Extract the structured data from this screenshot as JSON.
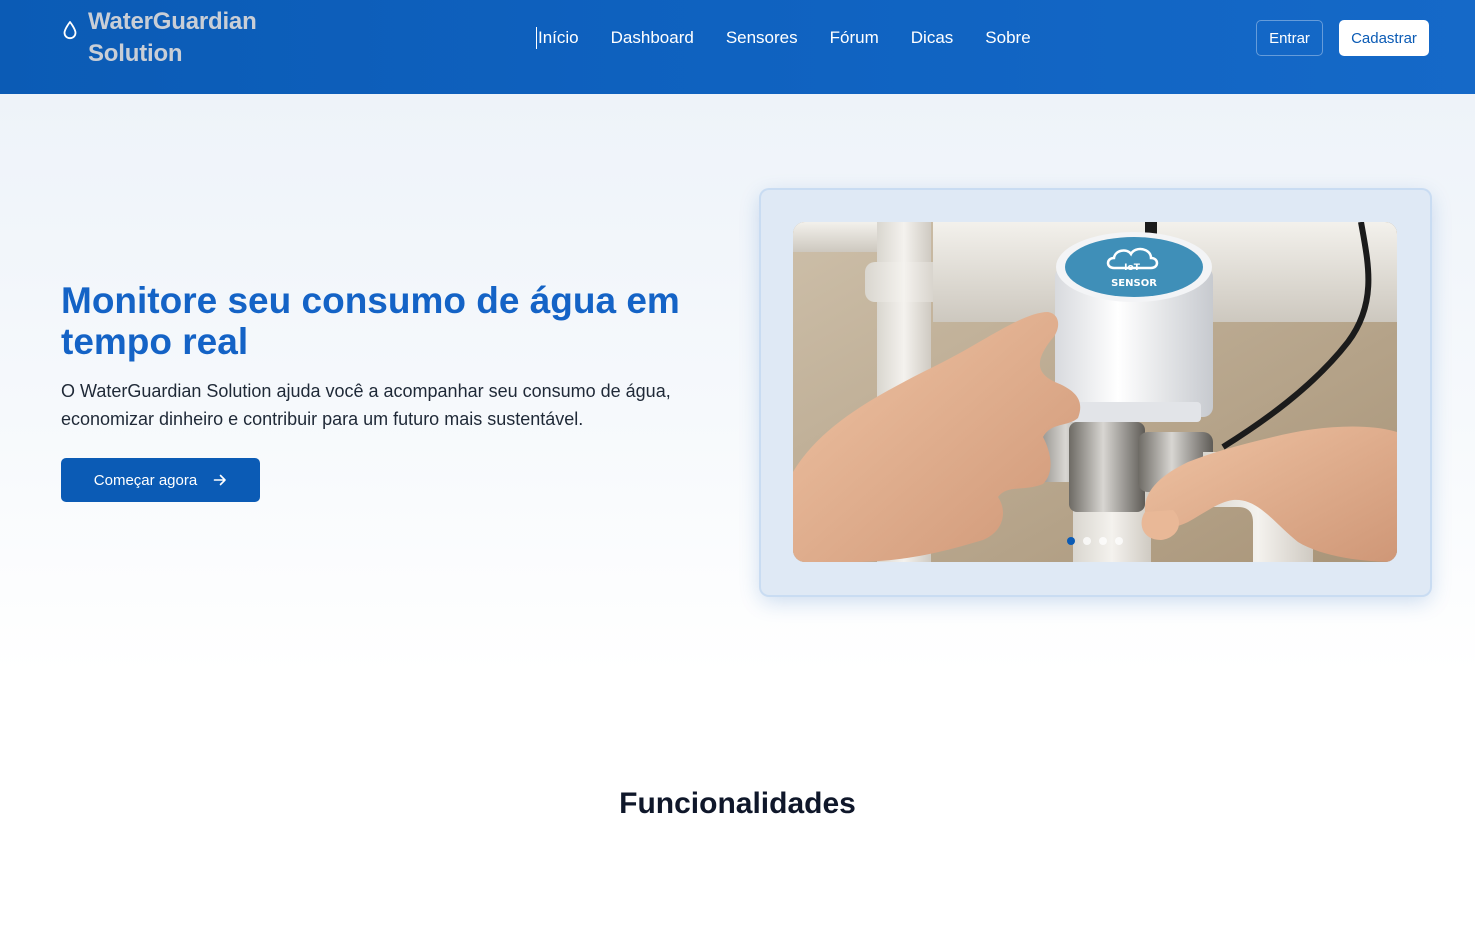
{
  "header": {
    "brand": "WaterGuardian Solution",
    "brand_icon": "water-drop-icon",
    "nav": [
      {
        "label": "Início"
      },
      {
        "label": "Dashboard"
      },
      {
        "label": "Sensores"
      },
      {
        "label": "Fórum"
      },
      {
        "label": "Dicas"
      },
      {
        "label": "Sobre"
      }
    ],
    "active_nav": "Início",
    "login_label": "Entrar",
    "signup_label": "Cadastrar"
  },
  "hero": {
    "title": "Monitore seu consumo de água em tempo real",
    "description": "O WaterGuardian Solution ajuda você a acompanhar seu consumo de água, economizar dinheiro e contribuir para um futuro mais sustentável.",
    "cta_label": "Começar agora",
    "cta_icon": "arrow-right-icon",
    "carousel": {
      "image_sensor_text": "SENSOR",
      "image_logo_text": "IoT",
      "slide_count": 4,
      "active_slide": 1
    }
  },
  "features": {
    "title": "Funcionalidades"
  },
  "colors": {
    "primary": "#0b5bb5",
    "hero_title": "#1463c6",
    "brand_text": "#c9ced6"
  }
}
